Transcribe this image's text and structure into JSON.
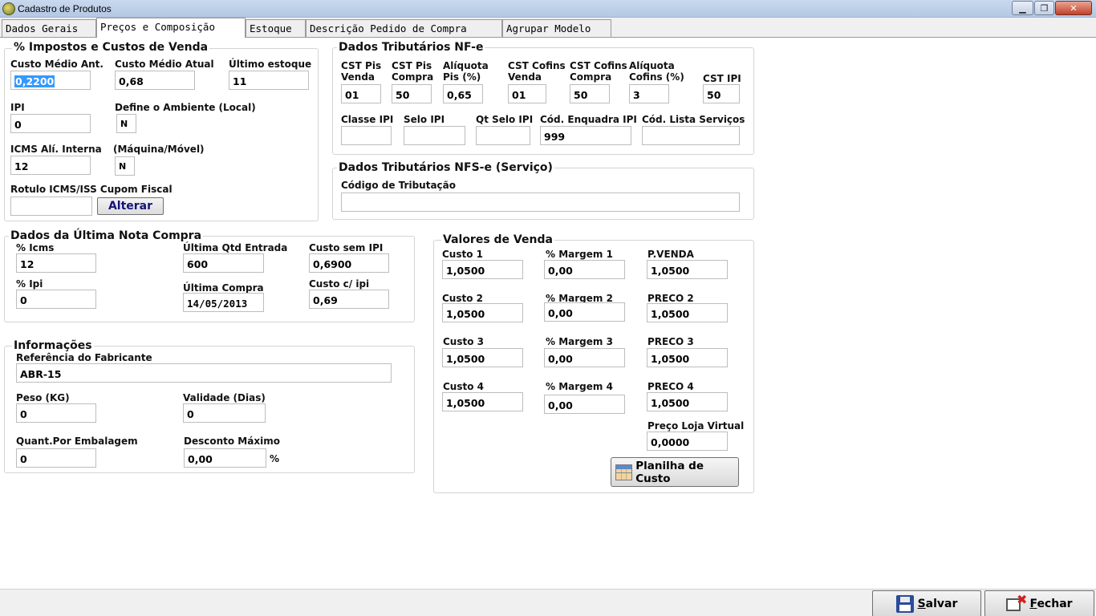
{
  "window": {
    "title": "Cadastro de Produtos",
    "btn_minimize": "▁",
    "btn_maximize": "❐",
    "btn_close": "✕"
  },
  "tabs": [
    "Dados Gerais",
    "Preços e Composição",
    "Estoque",
    "Descrição Pedido de Compra",
    "Agrupar Modelo"
  ],
  "impostos": {
    "title": "% Impostos e Custos de Venda",
    "custo_medio_ant_label": "Custo Médio Ant.",
    "custo_medio_ant": "0,2200",
    "custo_medio_atual_label": "Custo Médio Atual",
    "custo_medio_atual": "0,68",
    "ultimo_estoque_label": "Último estoque",
    "ultimo_estoque": "11",
    "ipi_label": "IPI",
    "ipi": "0",
    "ambiente_label": "Define o Ambiente (Local)",
    "ambiente": "N",
    "icms_label": "ICMS Alí. Interna",
    "icms": "12",
    "maquina_label": "(Máquina/Móvel)",
    "maquina": "N",
    "rotulo_label": "Rotulo ICMS/ISS Cupom Fiscal",
    "rotulo": "",
    "alterar_button": "Alterar"
  },
  "nfe": {
    "title": "Dados Tributários NF-e",
    "cst_pis_venda_label": "CST Pis Venda",
    "cst_pis_venda": "01",
    "cst_pis_compra_label": "CST Pis Compra",
    "cst_pis_compra": "50",
    "aliquota_pis_label": "Alíquota Pis (%)",
    "aliquota_pis": "0,65",
    "cst_cofins_venda_label": "CST Cofins Venda",
    "cst_cofins_venda": "01",
    "cst_cofins_compra_label": "CST Cofins Compra",
    "cst_cofins_compra": "50",
    "aliquota_cofins_label": "Alíquota Cofins (%)",
    "aliquota_cofins": "3",
    "cst_ipi_label": "CST IPI",
    "cst_ipi": "50",
    "classe_ipi_label": "Classe IPI",
    "classe_ipi": "",
    "selo_ipi_label": "Selo IPI",
    "selo_ipi": "",
    "qt_selo_ipi_label": "Qt Selo IPI",
    "qt_selo_ipi": "",
    "cod_enquadra_ipi_label": "Cód. Enquadra IPI",
    "cod_enquadra_ipi": "999",
    "cod_lista_servicos_label": "Cód. Lista Serviços",
    "cod_lista_servicos": ""
  },
  "nfse": {
    "title": "Dados Tributários NFS-e (Serviço)",
    "codigo_tributacao_label": "Código de Tributação",
    "codigo_tributacao": ""
  },
  "ultima_nota": {
    "title": "Dados da Última Nota Compra",
    "icms_label": "% Icms",
    "icms": "12",
    "qtd_entrada_label": "Última Qtd Entrada",
    "qtd_entrada": "600",
    "custo_sem_ipi_label": "Custo sem IPI",
    "custo_sem_ipi": "0,6900",
    "ipi_label": "% Ipi",
    "ipi": "0",
    "ultima_compra_label": "Última Compra",
    "ultima_compra": "14/05/2013",
    "custo_com_ipi_label": "Custo c/ ipi",
    "custo_com_ipi": "0,69"
  },
  "informacoes": {
    "title": "Informações",
    "referencia_label": "Referência do Fabricante",
    "referencia": "ABR-15",
    "peso_label": "Peso (KG)",
    "peso": "0",
    "validade_label": "Validade (Dias)",
    "validade": "0",
    "quant_embalagem_label": "Quant.Por Embalagem",
    "quant_embalagem": "0",
    "desconto_label": "Desconto Máximo",
    "desconto": "0,00",
    "desconto_unit": "%"
  },
  "valores_venda": {
    "title": "Valores de Venda",
    "rows": [
      {
        "custo_label": "Custo 1",
        "custo": "1,0500",
        "margem_label": "% Margem 1",
        "margem": "0,00",
        "preco_label": "P.VENDA",
        "preco": "1,0500"
      },
      {
        "custo_label": "Custo 2",
        "custo": "1,0500",
        "margem_label": "% Margem 2",
        "margem": "0,00",
        "preco_label": "PRECO 2",
        "preco": "1,0500"
      },
      {
        "custo_label": "Custo 3",
        "custo": "1,0500",
        "margem_label": "% Margem 3",
        "margem": "0,00",
        "preco_label": "PRECO 3",
        "preco": "1,0500"
      },
      {
        "custo_label": "Custo 4",
        "custo": "1,0500",
        "margem_label": "% Margem 4",
        "margem": "0,00",
        "preco_label": "PRECO 4",
        "preco": "1,0500"
      }
    ],
    "loja_virtual_label": "Preço Loja Virtual",
    "loja_virtual": "0,0000",
    "planilha_button": "Planilha de Custo"
  },
  "footer": {
    "salvar_first": "S",
    "salvar_rest": "alvar",
    "fechar_first": "F",
    "fechar_rest": "echar"
  }
}
